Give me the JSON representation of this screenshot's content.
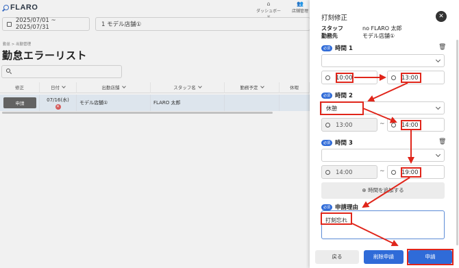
{
  "app": {
    "logo": "FLARO"
  },
  "nav": [
    {
      "label": "ダッシュボード",
      "icon": "home-icon"
    },
    {
      "label": "店舗管理",
      "icon": "people-icon"
    }
  ],
  "filters": {
    "date_range": "2025/07/01 ~ 2025/07/31",
    "store": "1 モデル店舗①"
  },
  "breadcrumb": "勤怠 > 出勤管理",
  "page_title": "勤怠エラーリスト",
  "table": {
    "columns": [
      "修正",
      "日付",
      "出勤店舗",
      "スタッフ名",
      "勤務予定",
      "休暇"
    ],
    "row": {
      "button": "申請",
      "date": "07/16(水)",
      "error_icon": "✕",
      "store": "モデル店舗①",
      "staff": "FLARO 太郎"
    }
  },
  "drawer": {
    "title": "打刻修正",
    "close_icon": "✕",
    "staff_label": "スタッフ",
    "staff_value": "no FLARO 太郎",
    "workplace_label": "勤務先",
    "workplace_value": "モデル店舗①",
    "required_tag": "必須",
    "time1": {
      "label": "時間 1",
      "select": "",
      "start": "10:00",
      "end": "13:00"
    },
    "time2": {
      "label": "時間 2",
      "select": "休憩",
      "start": "13:00",
      "end": "14:00"
    },
    "time3": {
      "label": "時間 3",
      "select": "",
      "start": "14:00",
      "end": "19:00"
    },
    "tilde": "~",
    "add_time": "⊕ 時間を追加する",
    "reason_label": "申請理由",
    "reason_value": "打刻忘れ",
    "buttons": {
      "back": "戻る",
      "delete": "削除申請",
      "apply": "申請"
    }
  },
  "colors": {
    "accent": "#2f6bd8",
    "highlight": "#e0251a",
    "selected_row": "#e9f2fb"
  }
}
